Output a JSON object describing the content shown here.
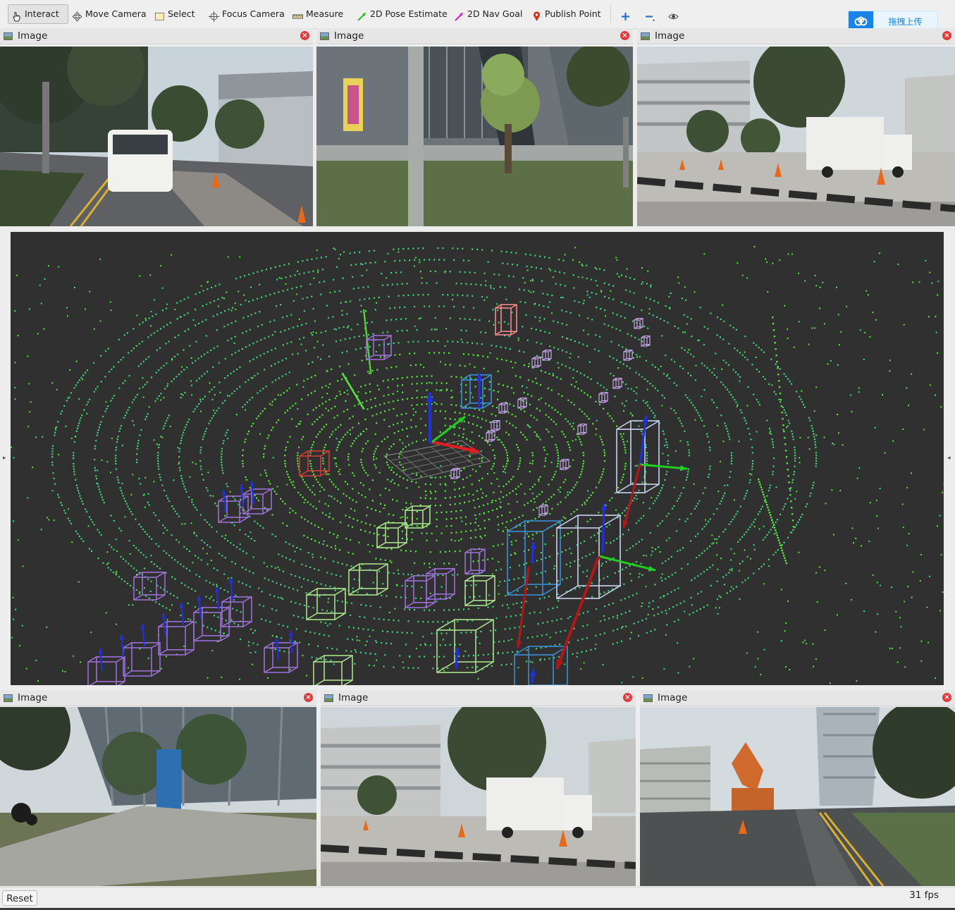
{
  "toolbar": {
    "tools": [
      {
        "label": "Interact",
        "icon": "hand-cursor-icon",
        "active": true
      },
      {
        "label": "Move Camera",
        "icon": "move-arrows-icon"
      },
      {
        "label": "Select",
        "icon": "selection-box-icon"
      },
      {
        "label": "Focus Camera",
        "icon": "crosshair-icon"
      },
      {
        "label": "Measure",
        "icon": "ruler-icon"
      },
      {
        "label": "2D Pose Estimate",
        "icon": "green-arrow-icon"
      },
      {
        "label": "2D Nav Goal",
        "icon": "magenta-arrow-icon"
      },
      {
        "label": "Publish Point",
        "icon": "map-pin-icon"
      }
    ],
    "add_icon": "plus-icon",
    "remove_icon": "minus-icon",
    "view_icon": "eye-icon"
  },
  "upload_widget": {
    "label": "拖拽上传",
    "icon": "cloud-icon"
  },
  "panels": {
    "top": [
      {
        "title": "Image",
        "close": "×"
      },
      {
        "title": "Image",
        "close": "×"
      },
      {
        "title": "Image",
        "close": "×"
      }
    ],
    "bottom": [
      {
        "title": "Image",
        "close": "×"
      },
      {
        "title": "Image",
        "close": "×"
      },
      {
        "title": "Image",
        "close": "×"
      }
    ]
  },
  "status": {
    "reset_label": "Reset",
    "fps": "31 fps"
  },
  "colors": {
    "viewport_bg": "#303030",
    "point_cloud": "#55e83a",
    "box_blue": "#3a8fd6",
    "box_purple": "#9a6fd4",
    "box_light_green": "#a8e28a",
    "box_white": "#c8d4ee",
    "box_red": "#d43a3a",
    "axis_x": "#e02020",
    "axis_y": "#20d020",
    "axis_z": "#2030e0"
  }
}
